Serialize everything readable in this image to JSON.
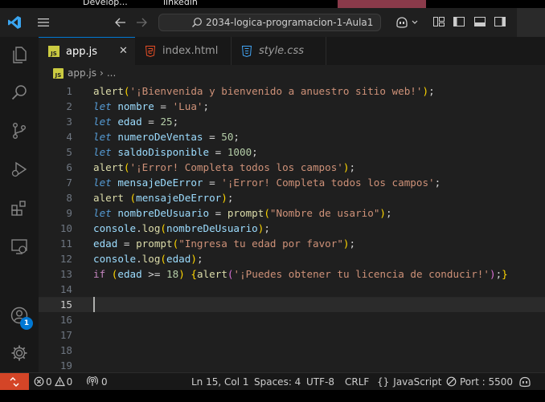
{
  "bookmarks": [
    "Develop...",
    "linkedin"
  ],
  "titlebar": {
    "search_text": "2034-logica-programacion-1-Aula1"
  },
  "tabs": [
    {
      "label": "app.js",
      "icon": "js-icon",
      "active": true
    },
    {
      "label": "index.html",
      "icon": "html5-icon",
      "active": false
    },
    {
      "label": "style.css",
      "icon": "css3-icon",
      "active": false
    }
  ],
  "breadcrumb": {
    "file": "app.js",
    "rest": "..."
  },
  "editor": {
    "line_numbers": [
      "1",
      "2",
      "3",
      "4",
      "5",
      "6",
      "7",
      "8",
      "9",
      "10",
      "11",
      "12",
      "13",
      "14",
      "15",
      "16",
      "17",
      "18",
      "19"
    ],
    "current_line": "15",
    "lines": [
      [
        [
          "fn",
          "alert"
        ],
        [
          "br1",
          "("
        ],
        [
          "str",
          "'¡Bienvenida y bienvenido a anuestro sitio web!'"
        ],
        [
          "br1",
          ")"
        ],
        [
          "pun",
          ";"
        ]
      ],
      [
        [
          "kw",
          "let"
        ],
        [
          "plain",
          " "
        ],
        [
          "var",
          "nombre"
        ],
        [
          "pun",
          " = "
        ],
        [
          "str",
          "'Lua'"
        ],
        [
          "pun",
          ";"
        ]
      ],
      [
        [
          "kw",
          "let"
        ],
        [
          "plain",
          " "
        ],
        [
          "var",
          "edad"
        ],
        [
          "pun",
          " = "
        ],
        [
          "num",
          "25"
        ],
        [
          "pun",
          ";"
        ]
      ],
      [
        [
          "kw",
          "let"
        ],
        [
          "plain",
          " "
        ],
        [
          "var",
          "numeroDeVentas"
        ],
        [
          "pun",
          " = "
        ],
        [
          "num",
          "50"
        ],
        [
          "pun",
          ";"
        ]
      ],
      [
        [
          "kw",
          "let"
        ],
        [
          "plain",
          " "
        ],
        [
          "var",
          "saldoDisponible"
        ],
        [
          "pun",
          " = "
        ],
        [
          "num",
          "1000"
        ],
        [
          "pun",
          ";"
        ]
      ],
      [
        [
          "fn",
          "alert"
        ],
        [
          "br1",
          "("
        ],
        [
          "str",
          "'¡Error! Completa todos los campos'"
        ],
        [
          "br1",
          ")"
        ],
        [
          "pun",
          ";"
        ]
      ],
      [
        [
          "kw",
          "let"
        ],
        [
          "plain",
          " "
        ],
        [
          "var",
          "mensajeDeError"
        ],
        [
          "pun",
          " = "
        ],
        [
          "str",
          "'¡Error! Completa todos los campos'"
        ],
        [
          "pun",
          ";"
        ]
      ],
      [
        [
          "fn",
          "alert"
        ],
        [
          "plain",
          " "
        ],
        [
          "br1",
          "("
        ],
        [
          "var",
          "mensajeDeError"
        ],
        [
          "br1",
          ")"
        ],
        [
          "pun",
          ";"
        ]
      ],
      [
        [
          "kw",
          "let"
        ],
        [
          "plain",
          " "
        ],
        [
          "var",
          "nombreDeUsuario"
        ],
        [
          "pun",
          " = "
        ],
        [
          "fn",
          "prompt"
        ],
        [
          "br1",
          "("
        ],
        [
          "str",
          "\"Nombre de usario\""
        ],
        [
          "br1",
          ")"
        ],
        [
          "pun",
          ";"
        ]
      ],
      [
        [
          "var",
          "console"
        ],
        [
          "pun",
          "."
        ],
        [
          "fn",
          "log"
        ],
        [
          "br1",
          "("
        ],
        [
          "var",
          "nombreDeUsuario"
        ],
        [
          "br1",
          ")"
        ],
        [
          "pun",
          ";"
        ]
      ],
      [
        [
          "var",
          "edad"
        ],
        [
          "pun",
          " = "
        ],
        [
          "fn",
          "prompt"
        ],
        [
          "br1",
          "("
        ],
        [
          "str",
          "\"Ingresa tu edad por favor\""
        ],
        [
          "br1",
          ")"
        ],
        [
          "pun",
          ";"
        ]
      ],
      [
        [
          "var",
          "console"
        ],
        [
          "pun",
          "."
        ],
        [
          "fn",
          "log"
        ],
        [
          "br1",
          "("
        ],
        [
          "var",
          "edad"
        ],
        [
          "br1",
          ")"
        ],
        [
          "pun",
          ";"
        ]
      ],
      [
        [
          "ctl",
          "if"
        ],
        [
          "plain",
          " "
        ],
        [
          "br1",
          "("
        ],
        [
          "var",
          "edad"
        ],
        [
          "pun",
          " >= "
        ],
        [
          "num",
          "18"
        ],
        [
          "br1",
          ")"
        ],
        [
          "plain",
          " "
        ],
        [
          "br1",
          "{"
        ],
        [
          "fn",
          "alert"
        ],
        [
          "br2",
          "("
        ],
        [
          "str",
          "'¡Puedes obtener tu licencia de conducir!'"
        ],
        [
          "br2",
          ")"
        ],
        [
          "pun",
          ";"
        ],
        [
          "br1",
          "}"
        ]
      ],
      [],
      [],
      [],
      [],
      [],
      []
    ]
  },
  "activity": {
    "accounts_badge": "1"
  },
  "status": {
    "errors": "0",
    "warnings": "0",
    "ports_count": "0",
    "position": "Ln 15, Col 1",
    "spaces": "Spaces: 4",
    "encoding": "UTF-8",
    "eol": "CRLF",
    "language": "JavaScript",
    "port": "Port : 5500"
  },
  "colors": {
    "accent": "#0078d4",
    "remote": "#d44527",
    "editor_bg": "#1f1f1f"
  }
}
